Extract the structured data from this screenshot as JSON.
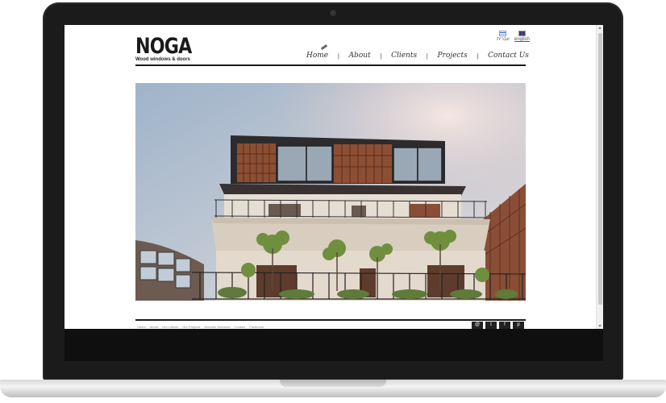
{
  "site": {
    "logo_title": "NOGA",
    "logo_subtitle": "Wood windows & doors"
  },
  "lang": {
    "hebrew_label": "עברית",
    "english_label": "english"
  },
  "nav": {
    "items": [
      {
        "label": "Home",
        "active": true
      },
      {
        "label": "About"
      },
      {
        "label": "Clients"
      },
      {
        "label": "Projects"
      },
      {
        "label": "Contact Us"
      }
    ],
    "separator": "|"
  },
  "hero": {
    "icon": "building-photo",
    "sky_color": "#b9c7d6",
    "wall_color": "#e9ddd0",
    "wood_color": "#7a4a30"
  },
  "footer": {
    "links": [
      "Home",
      "About",
      "Our Clients",
      "Our Projects",
      "Wooden Windows",
      "Contact",
      "Facebook"
    ],
    "social": [
      {
        "icon": "email-icon",
        "glyph": "@"
      },
      {
        "icon": "twitter-icon",
        "glyph": "t"
      },
      {
        "icon": "facebook-icon",
        "glyph": "f"
      },
      {
        "icon": "pinterest-icon",
        "glyph": "p"
      }
    ]
  }
}
